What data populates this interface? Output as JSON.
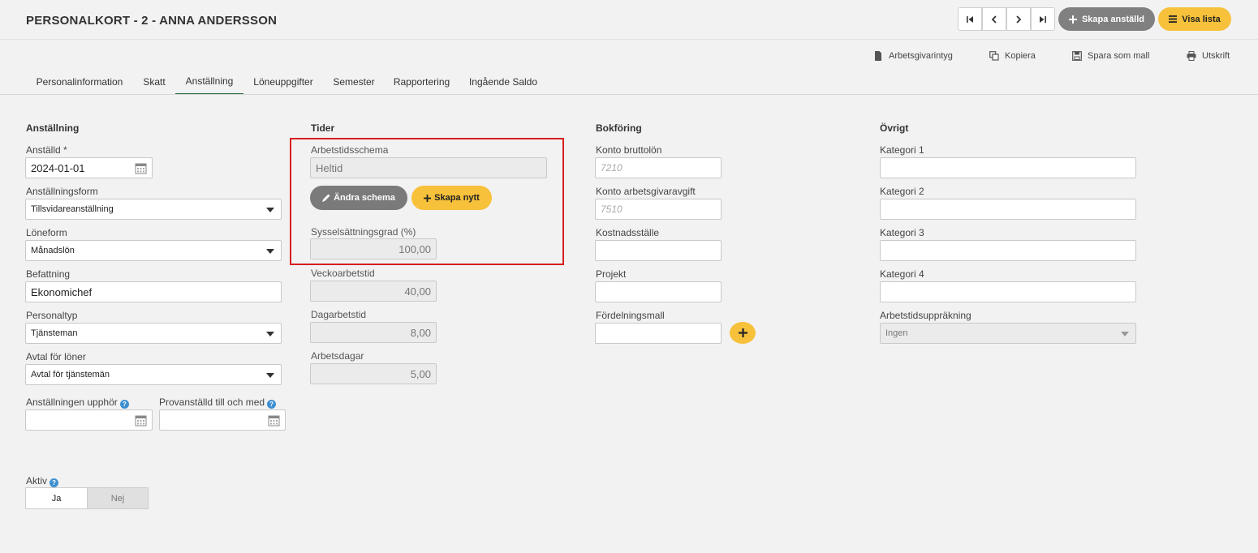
{
  "header": {
    "title": "PERSONALKORT - 2 - ANNA ANDERSSON",
    "create_employee_label": "Skapa anställd",
    "show_list_label": "Visa lista"
  },
  "toolbar": {
    "employer_cert": "Arbetsgivarintyg",
    "copy": "Kopiera",
    "save_template": "Spara som mall",
    "print": "Utskrift"
  },
  "tabs": [
    {
      "label": "Personalinformation"
    },
    {
      "label": "Skatt"
    },
    {
      "label": "Anställning",
      "active": true
    },
    {
      "label": "Löneuppgifter"
    },
    {
      "label": "Semester"
    },
    {
      "label": "Rapportering"
    },
    {
      "label": "Ingående Saldo"
    }
  ],
  "employment": {
    "title": "Anställning",
    "employed_label": "Anställd *",
    "employed_value": "2024-01-01",
    "employment_form_label": "Anställningsform",
    "employment_form_value": "Tillsvidareanställning",
    "salary_form_label": "Löneform",
    "salary_form_value": "Månadslön",
    "position_label": "Befattning",
    "position_value": "Ekonomichef",
    "staff_type_label": "Personaltyp",
    "staff_type_value": "Tjänsteman",
    "agreement_label": "Avtal för löner",
    "agreement_value": "Avtal för tjänstemän",
    "end_label": "Anställningen upphör",
    "end_value": "",
    "probation_label": "Provanställd till och med",
    "probation_value": "",
    "active_label": "Aktiv",
    "active_yes": "Ja",
    "active_no": "Nej"
  },
  "times": {
    "title": "Tider",
    "schedule_label": "Arbetstidsschema",
    "schedule_value": "Heltid",
    "change_schedule": "Ändra schema",
    "create_new": "Skapa nytt",
    "employment_rate_label": "Sysselsättningsgrad (%)",
    "employment_rate_value": "100,00",
    "weekly_hours_label": "Veckoarbetstid",
    "weekly_hours_value": "40,00",
    "daily_hours_label": "Dagarbetstid",
    "daily_hours_value": "8,00",
    "workdays_label": "Arbetsdagar",
    "workdays_value": "5,00"
  },
  "bookkeeping": {
    "title": "Bokföring",
    "gross_account_label": "Konto bruttolön",
    "gross_account_placeholder": "7210",
    "employer_fee_account_label": "Konto arbetsgivaravgift",
    "employer_fee_account_placeholder": "7510",
    "cost_center_label": "Kostnadsställe",
    "cost_center_value": "",
    "project_label": "Projekt",
    "project_value": "",
    "distribution_label": "Fördelningsmall",
    "distribution_value": ""
  },
  "other": {
    "title": "Övrigt",
    "category1_label": "Kategori 1",
    "category2_label": "Kategori 2",
    "category3_label": "Kategori 3",
    "category4_label": "Kategori 4",
    "worktime_adjust_label": "Arbetstidsuppräkning",
    "worktime_adjust_value": "Ingen"
  },
  "colors": {
    "accent_yellow": "#f7c13b",
    "grey_button": "#7a7a7a",
    "active_tab_underline": "#2d6b3d",
    "highlight_red": "#d61f1f",
    "help_blue": "#3d8fd1"
  }
}
